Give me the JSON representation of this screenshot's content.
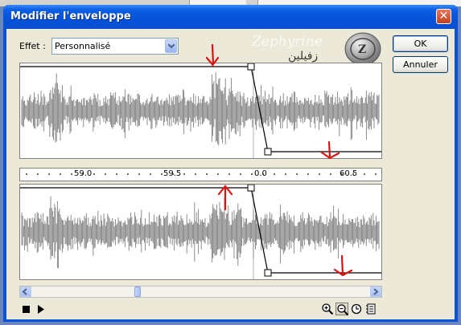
{
  "window": {
    "title": "Modifier l'enveloppe",
    "close_glyph": "✕"
  },
  "effect": {
    "label": "Effet :",
    "selected": "Personnalisé"
  },
  "buttons": {
    "ok": "OK",
    "cancel": "Annuler"
  },
  "watermark": {
    "latin": "Zephyrine",
    "arabic": "زفيلين"
  },
  "ruler": {
    "ticks": [
      "59.0",
      "59.5",
      "0.0",
      "60.5"
    ]
  },
  "envelope": {
    "top_channel": {
      "level_before": 1.0,
      "level_after": 0.0
    },
    "bottom_channel": {
      "level_before": 1.0,
      "level_after": 0.0
    }
  },
  "scroll": {
    "position": 0.31
  },
  "icons": {
    "stop": "stop-icon",
    "play": "play-icon",
    "zoom_in": "zoom-in-icon",
    "zoom_out": "zoom-out-icon",
    "zoom_full": "zoom-full-icon",
    "zoom_selection": "zoom-selection-icon"
  },
  "colors": {
    "title_bar": "#0a53d8",
    "dialog_bg": "#ece9d8",
    "waveform": "#808080",
    "selection_bg": "#ffffff",
    "annotation": "#dd1111"
  }
}
